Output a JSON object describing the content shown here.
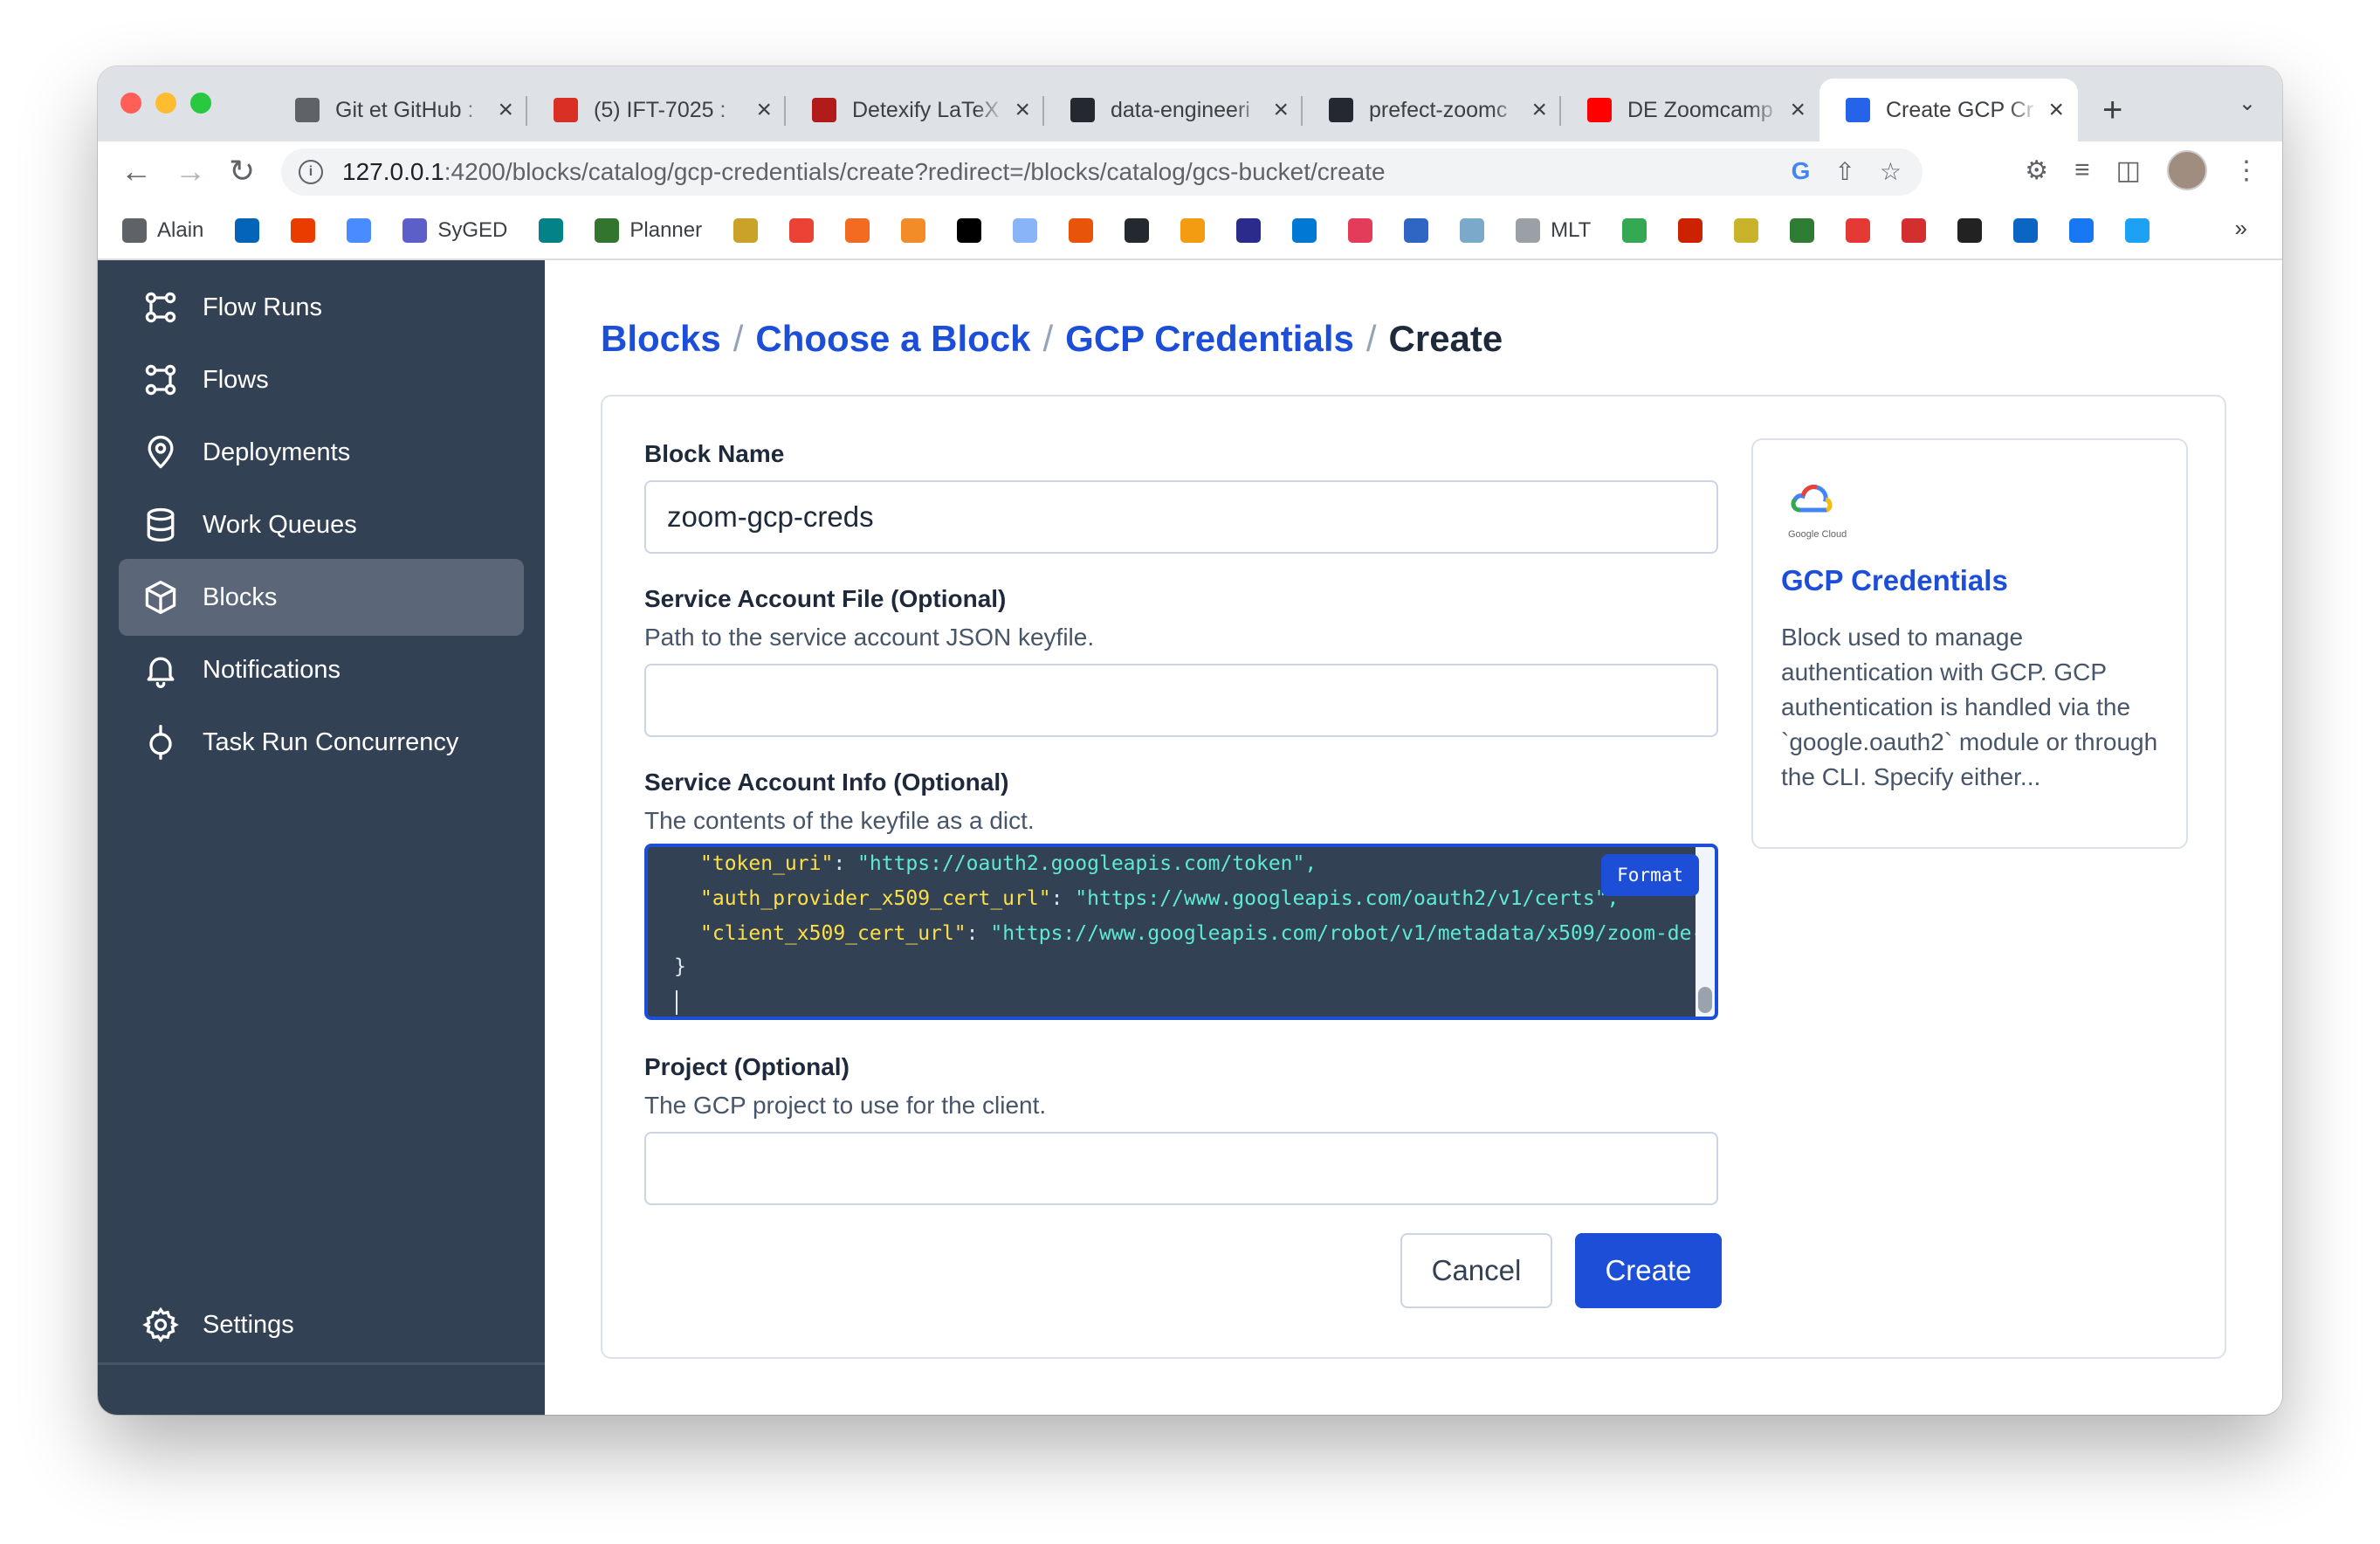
{
  "browser": {
    "tabs": [
      {
        "label": "Git et GitHub :",
        "icon": "globe-icon",
        "color": "#5f6368"
      },
      {
        "label": "(5) IFT-7025 :",
        "icon": "ulaval-icon",
        "color": "#d93025"
      },
      {
        "label": "Detexify LaTeX",
        "icon": "detexify-icon",
        "color": "#b31b1b"
      },
      {
        "label": "data-engineeri",
        "icon": "github-icon",
        "color": "#24292f"
      },
      {
        "label": "prefect-zoomc",
        "icon": "github-icon",
        "color": "#24292f"
      },
      {
        "label": "DE Zoomcamp",
        "icon": "youtube-icon",
        "color": "#ff0000"
      },
      {
        "label": "Create GCP Cr",
        "icon": "prefect-icon",
        "color": "#2563eb"
      }
    ],
    "url_host": "127.0.0.1",
    "url_path": ":4200/blocks/catalog/gcp-credentials/create?redirect=/blocks/catalog/gcs-bucket/create",
    "bookmarks": [
      {
        "label": "Alain",
        "color": "#5f6368"
      },
      {
        "label": "",
        "color": "#0364b8"
      },
      {
        "label": "",
        "color": "#eb3c00"
      },
      {
        "label": "",
        "color": "#4a8cff"
      },
      {
        "label": "SyGED",
        "color": "#5b5fc7"
      },
      {
        "label": "",
        "color": "#038387"
      },
      {
        "label": "Planner",
        "color": "#31752f"
      },
      {
        "label": "",
        "color": "#c9a227"
      },
      {
        "label": "",
        "color": "#ea4335"
      },
      {
        "label": "",
        "color": "#f26b21"
      },
      {
        "label": "",
        "color": "#f28c28"
      },
      {
        "label": "",
        "color": "#000000"
      },
      {
        "label": "",
        "color": "#8ab4f8"
      },
      {
        "label": "",
        "color": "#e8540a"
      },
      {
        "label": "",
        "color": "#24292f"
      },
      {
        "label": "",
        "color": "#f39c12"
      },
      {
        "label": "",
        "color": "#2b2b8c"
      },
      {
        "label": "",
        "color": "#0078d4"
      },
      {
        "label": "",
        "color": "#e23c5a"
      },
      {
        "label": "",
        "color": "#2f66c4"
      },
      {
        "label": "",
        "color": "#7aa9c9"
      },
      {
        "label": "MLT",
        "color": "#9aa0a6"
      },
      {
        "label": "",
        "color": "#34a853"
      },
      {
        "label": "",
        "color": "#cc2200"
      },
      {
        "label": "",
        "color": "#c9b32a"
      },
      {
        "label": "",
        "color": "#2e7d32"
      },
      {
        "label": "",
        "color": "#e53935"
      },
      {
        "label": "",
        "color": "#d32f2f"
      },
      {
        "label": "",
        "color": "#222222"
      },
      {
        "label": "",
        "color": "#0a66c2"
      },
      {
        "label": "",
        "color": "#1877f2"
      },
      {
        "label": "",
        "color": "#1da1f2"
      }
    ],
    "bookmarks_more": "»"
  },
  "sidebar": {
    "items": [
      {
        "label": "Flow Runs",
        "icon": "flow-runs-icon"
      },
      {
        "label": "Flows",
        "icon": "flows-icon"
      },
      {
        "label": "Deployments",
        "icon": "location-pin-icon"
      },
      {
        "label": "Work Queues",
        "icon": "database-icon"
      },
      {
        "label": "Blocks",
        "icon": "cube-icon",
        "active": true
      },
      {
        "label": "Notifications",
        "icon": "bell-icon"
      },
      {
        "label": "Task Run Concurrency",
        "icon": "concurrency-icon"
      }
    ],
    "settings": "Settings"
  },
  "breadcrumb": {
    "blocks": "Blocks",
    "choose": "Choose a Block",
    "gcp": "GCP Credentials",
    "current": "Create",
    "sep": "/"
  },
  "form": {
    "block_name": {
      "label": "Block Name",
      "value": "zoom-gcp-creds"
    },
    "service_account_file": {
      "label": "Service Account File (Optional)",
      "description": "Path to the service account JSON keyfile.",
      "value": ""
    },
    "service_account_info": {
      "label": "Service Account Info (Optional)",
      "description": "The contents of the keyfile as a dict.",
      "lines": [
        {
          "key": "\"token_uri\"",
          "value": "\"https://oauth2.googleapis.com/token\","
        },
        {
          "key": "\"auth_provider_x509_cert_url\"",
          "value": "\"https://www.googleapis.com/oauth2/v1/certs\","
        },
        {
          "key": "\"client_x509_cert_url\"",
          "value": "\"https://www.googleapis.com/robot/v1/metadata/x509/zoom-de-"
        }
      ],
      "closing": "}",
      "format_button": "Format"
    },
    "project": {
      "label": "Project (Optional)",
      "description": "The GCP project to use for the client.",
      "value": ""
    },
    "cancel": "Cancel",
    "create": "Create"
  },
  "block_card": {
    "logo_caption": "Google Cloud",
    "title": "GCP Credentials",
    "description": "Block used to manage authentication with GCP. GCP authentication is handled via the `google.oauth2` module or through the CLI. Specify either..."
  }
}
